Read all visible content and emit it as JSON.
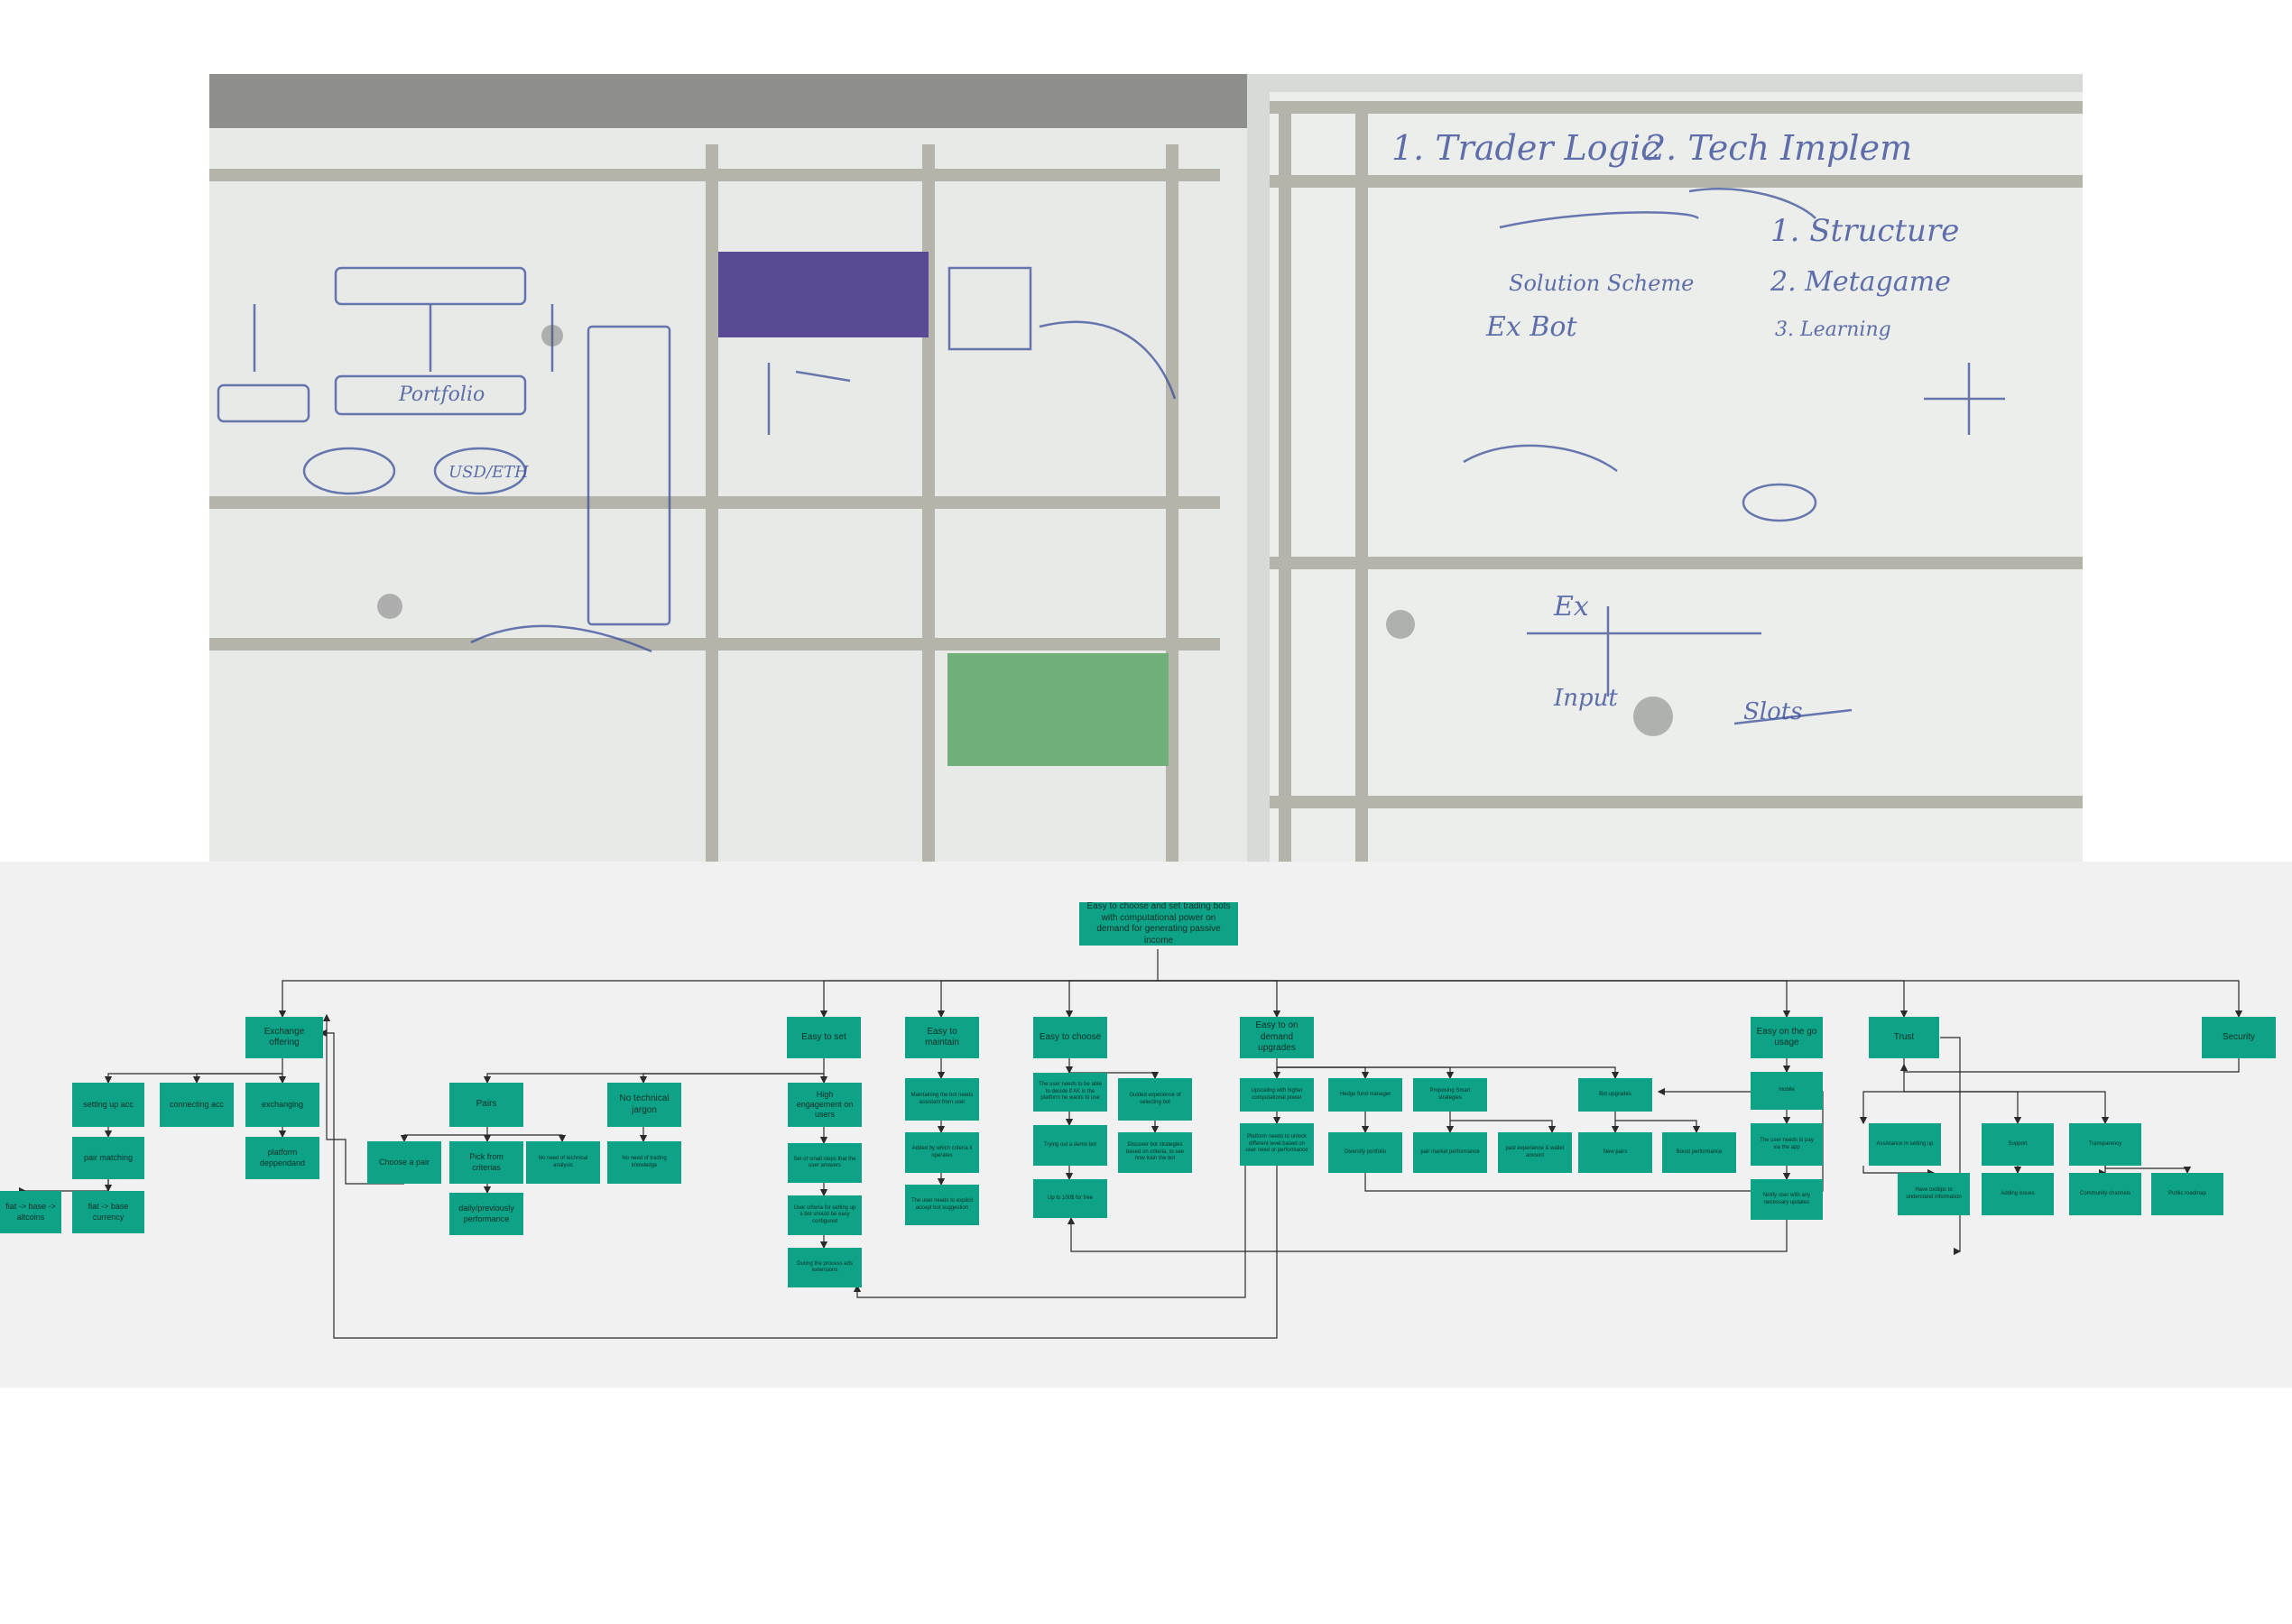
{
  "photo": {
    "alt": "",
    "whiteboard_words": [
      "1. Trader Logic",
      "2. Tech Implem",
      "1. Structure",
      "2. Metagame",
      "3. Learning",
      "Portfolio",
      "USD/ETH",
      "Solution Scheme",
      "Ex Bot",
      "Ex",
      "Input",
      "Slots"
    ]
  },
  "tree": {
    "root": "Easy to choose and set trading bots with computational power on demand for generating passive income",
    "exchange_offering": "Exchange offering",
    "setting_up_acc": "setting up acc",
    "connecting_acc": "connecting acc",
    "exchanging": "exchanging",
    "pair_matching": "pair matching",
    "platform_dependand": "platform deppendand",
    "fiat_altcoins": "fiat -> base -> altcoins",
    "fiat_base_currency": "fiat -> base currency",
    "pairs": "Pairs",
    "no_technical_jargon": "No technical jargon",
    "choose_a_pair": "Choose a pair",
    "pick_from_criterias": "Pick from criterias",
    "no_need_technical_analysis": "No need of technical analysis",
    "no_need_trading_knowledge": "No need of trading knowledge",
    "daily_performance": "daily/previously performance",
    "easy_to_set": "Easy to set",
    "high_engagement": "High engagement on users",
    "set_of_small_steps": "Set of small steps that the user answers",
    "user_criteria_setting_up": "User criteria for setting up a bot should be easy configured",
    "during_process_extensions": "During the process ads extensions",
    "easy_to_maintain": "Easy to maintain",
    "maintaining_bot": "Maintaining the bot needs assistant from user",
    "added_by_criteria": "Added by which criteria it operates",
    "user_needs_accept": "The user needs to explicit accept bot suggestion",
    "easy_to_choose": "Easy to choose",
    "user_needs_decide": "The user needs to be able to decide if AK is the platform he wants to use",
    "trying_out_demo": "Trying out a demo bot",
    "up_to_100": "Up to 100$ for free",
    "guided_experience": "Guided experience of selecting bot",
    "discover_strategies": "Discover bot strategies based on criteria, to see how train the bot",
    "easy_on_demand": "Easy to on demand upgrades",
    "upscaling": "Upscaling with higher computational power",
    "platform_needs_unlock": "Platform needs to unlock different level based on user need or performance",
    "hedge_fund": "Hedge fund manager",
    "diversify_portfolio": "Diversify portfolio",
    "proposing_smart": "Proposing Smart strategies",
    "pair_market": "pair market performance",
    "past_experience": "past experience & wallet amount",
    "bot_upgrades": "Bot upgrades",
    "new_pairs": "New pairs",
    "boost_performance": "Boost performance",
    "easy_on_the_go": "Easy on the go usage",
    "mobile": "mobile",
    "user_pay_app": "The user needs to pay via the app",
    "notify_user": "Notify user with any necessary updates",
    "trust": "Trust",
    "assistance_setting_up": "Assistance in setting up",
    "support": "Support",
    "transparency": "Transparency",
    "have_tooltips": "Have tooltips to understand information",
    "adding_issues": "Adding issues",
    "community_channels": "Community channels",
    "public_roadmap": "Public roadmap",
    "security": "Security"
  },
  "colors": {
    "node": "#0ea287",
    "panel": "#f1f1f1",
    "line": "#2b2b2b"
  }
}
